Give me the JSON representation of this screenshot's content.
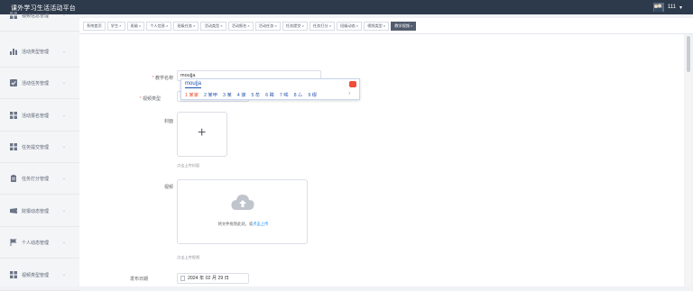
{
  "app": {
    "title": "课外学习生活活动平台"
  },
  "user": {
    "name": "111",
    "caret": "▾"
  },
  "sidebar": {
    "items": [
      {
        "label": "视频信息管理",
        "icon": "grid-icon"
      },
      {
        "label": "活动类型管理",
        "icon": "bar-chart-icon"
      },
      {
        "label": "活动任务管理",
        "icon": "check-square-icon"
      },
      {
        "label": "活动报名管理",
        "icon": "grid-icon"
      },
      {
        "label": "任务提交管理",
        "icon": "grid-icon"
      },
      {
        "label": "任务打分管理",
        "icon": "clipboard-icon"
      },
      {
        "label": "财报动态管理",
        "icon": "ticket-icon"
      },
      {
        "label": "个人动态管理",
        "icon": "flag-icon"
      },
      {
        "label": "视频类型管理",
        "icon": "grid-icon"
      }
    ],
    "chevron": "⌄"
  },
  "tabs": [
    {
      "label": "系统首页",
      "closable": false,
      "active": false
    },
    {
      "label": "学生",
      "closable": true,
      "active": false
    },
    {
      "label": "班级",
      "closable": true,
      "active": false
    },
    {
      "label": "个人信息",
      "closable": true,
      "active": false
    },
    {
      "label": "班级任务",
      "closable": true,
      "active": false
    },
    {
      "label": "活动类型",
      "closable": true,
      "active": false
    },
    {
      "label": "活动报名",
      "closable": true,
      "active": false
    },
    {
      "label": "活动任务",
      "closable": true,
      "active": false
    },
    {
      "label": "任务提交",
      "closable": true,
      "active": false
    },
    {
      "label": "任务打分",
      "closable": true,
      "active": false
    },
    {
      "label": "班级动态",
      "closable": true,
      "active": false
    },
    {
      "label": "视频类型",
      "closable": true,
      "active": false
    },
    {
      "label": "教学视频",
      "closable": true,
      "active": true
    }
  ],
  "tab_close": "×",
  "form": {
    "required_mark": "*",
    "name_label": "教学名称",
    "name_value": "mou|ja",
    "type_label": "视频类型",
    "cover_label": "封面",
    "cover_plus": "+",
    "cover_hint": "点击上传封面",
    "video_label": "视频",
    "video_text": "将文件拖到此处，或",
    "video_link": "点击上传",
    "video_hint": "点击上传视频",
    "date_label": "发布日期",
    "date_value": "2024 年 02 月 29 日"
  },
  "ime": {
    "composition": "mou|ja",
    "candidates": [
      "1 某家",
      "2 某甲",
      "3 某",
      "4 谋",
      "5 牟",
      "6 眸",
      "7 哞",
      "8 厶",
      "9 缪"
    ],
    "more": "›"
  },
  "colors": {
    "topbar": "#2d3a4b",
    "active_tab": "#525c6e",
    "link": "#1890ff",
    "required": "#f56c6c"
  }
}
